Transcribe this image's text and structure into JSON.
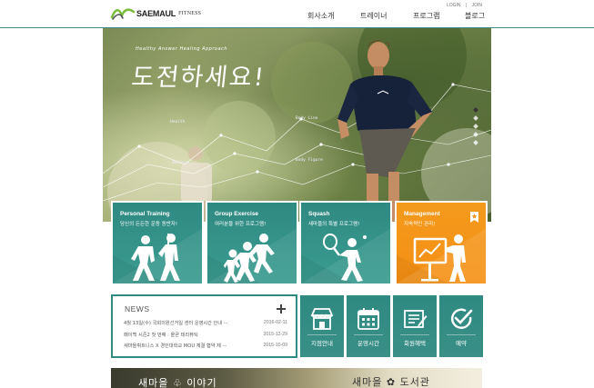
{
  "header": {
    "logo": {
      "brand": "SAEMAUL",
      "sub": "FITNESS"
    },
    "util": {
      "login": "LOGIN",
      "join": "JOIN",
      "sep": "|"
    },
    "nav": [
      "회사소개",
      "트레이너",
      "프로그램",
      "블로그"
    ],
    "accent": "#3a8c86"
  },
  "hero": {
    "tagline": "Healthy Answer  Healing Approach",
    "title": "도전하세요!",
    "points": [
      "Health",
      "Balance",
      "Body Line",
      "Body Figure"
    ],
    "slides": 5,
    "active_slide": 1
  },
  "programs": [
    {
      "title": "Personal Training",
      "subtitle": "당신의 든든한 운동 동반자!",
      "icon": "personal-training-icon",
      "color": "#2f8a82"
    },
    {
      "title": "Group Exercise",
      "subtitle": "여러분을 위한 프로그램!",
      "icon": "group-running-icon",
      "color": "#2f8a82"
    },
    {
      "title": "Squash",
      "subtitle": "새마을의 특별 프로그램!",
      "icon": "squash-player-icon",
      "color": "#2f8a82"
    },
    {
      "title": "Management",
      "subtitle": "지속적인 관리!",
      "icon": "presentation-chart-icon",
      "color": "#f5921a"
    }
  ],
  "news": {
    "title": "NEWS",
    "items": [
      {
        "text": "4월 13일(수) 국회의원선거일 센터 운영시간 안내 ···",
        "date": "2016-02-11"
      },
      {
        "text": "패이백 시즌2 첫 번째 : 올곧 테라퓨틱",
        "date": "2015-12-29"
      },
      {
        "text": "새마을휘트니스 X 경인대학교 MOU 체결 협약 체 ···",
        "date": "2015-10-09"
      }
    ]
  },
  "quick_links": [
    {
      "label": "지점안내",
      "icon": "store-icon"
    },
    {
      "label": "운영시간",
      "icon": "calendar-icon"
    },
    {
      "label": "회원혜택",
      "icon": "membership-card-icon"
    },
    {
      "label": "예약",
      "icon": "check-circle-icon"
    }
  ],
  "banner": {
    "left": "새마을 ♧ 이야기",
    "right": "새마을 ✿ 도서관"
  }
}
